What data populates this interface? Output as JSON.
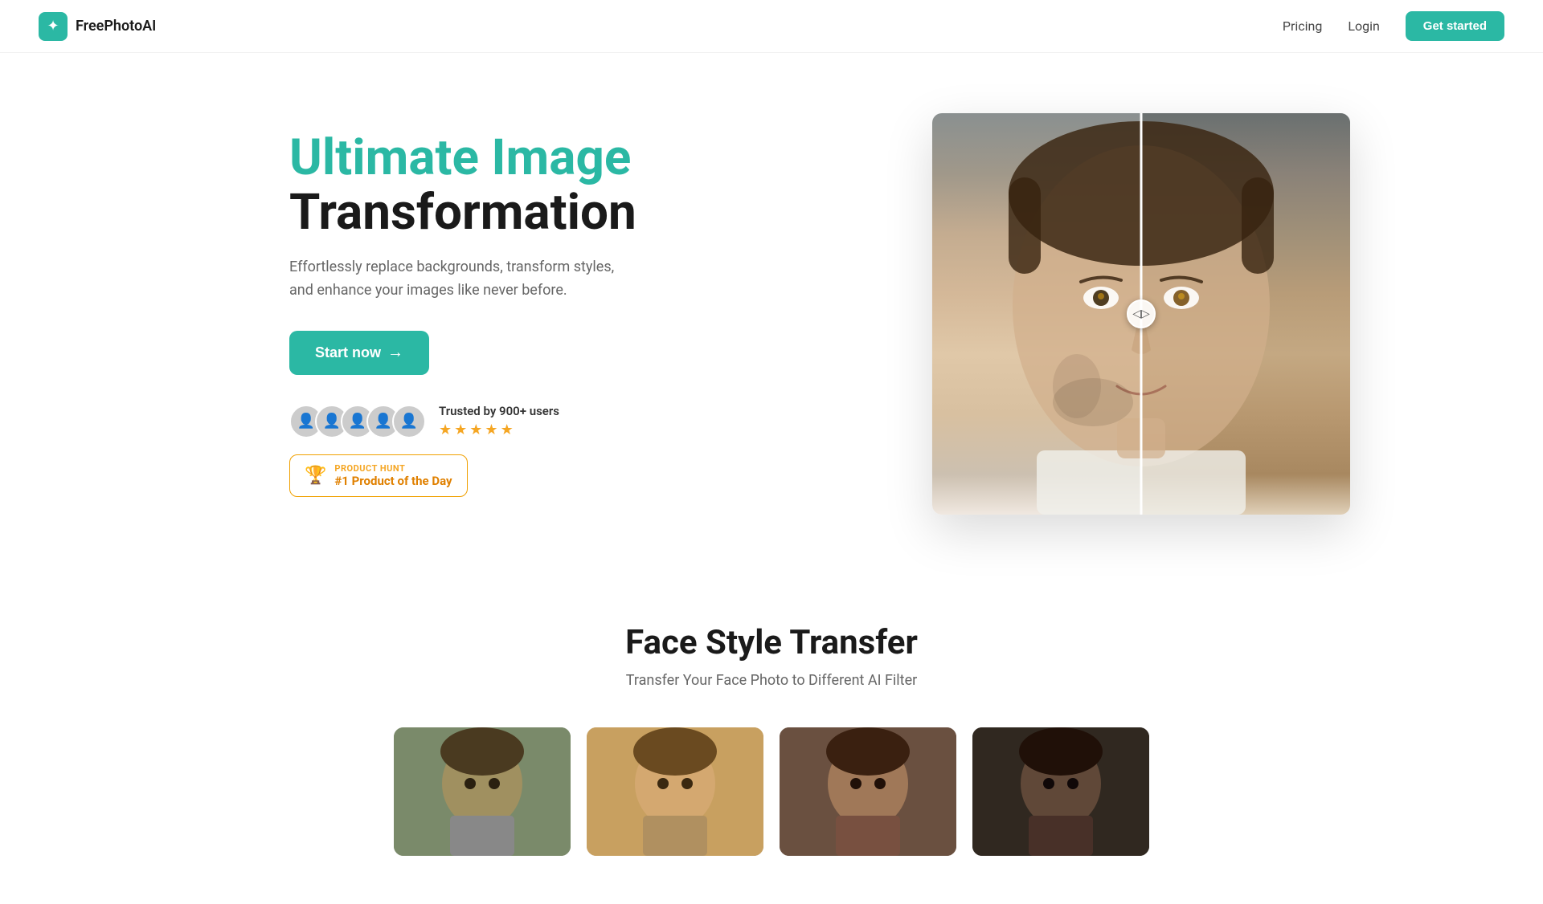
{
  "nav": {
    "logo_icon": "✦",
    "logo_text": "FreePhotoAI",
    "links": [
      {
        "label": "Pricing",
        "id": "pricing"
      },
      {
        "label": "Login",
        "id": "login"
      }
    ],
    "cta_label": "Get started"
  },
  "hero": {
    "title_accent": "Ultimate Image",
    "title_dark": "Transformation",
    "subtitle": "Effortlessly replace backgrounds, transform styles, and enhance your images like never before.",
    "cta_label": "Start now",
    "cta_arrow": "→",
    "social_proof": {
      "trusted_text": "Trusted by 900+ users",
      "star_count": 5
    },
    "product_hunt": {
      "label": "PRODUCT HUNT",
      "title": "#1 Product of the Day"
    },
    "compare_handle": "◁▷"
  },
  "fst": {
    "title": "Face Style Transfer",
    "subtitle": "Transfer Your Face Photo to Different AI Filter"
  }
}
